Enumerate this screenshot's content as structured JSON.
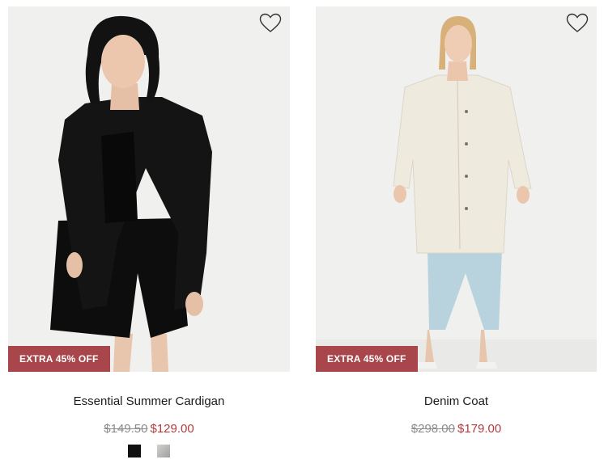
{
  "products": [
    {
      "name": "Essential Summer Cardigan",
      "badge": "EXTRA 45% OFF",
      "original_price": "$149.50",
      "sale_price": "$129.00",
      "swatches": [
        {
          "name": "black",
          "color": "#111111"
        },
        {
          "name": "grey",
          "color": "#b8b8b6"
        }
      ]
    },
    {
      "name": "Denim Coat",
      "badge": "EXTRA 45% OFF",
      "original_price": "$298.00",
      "sale_price": "$179.00",
      "swatches": []
    }
  ],
  "icons": {
    "wishlist": "heart-outline-icon"
  },
  "colors": {
    "badge_bg": "#a8464b",
    "sale_price": "#b33a3f",
    "original_price": "#8b8b8b"
  }
}
